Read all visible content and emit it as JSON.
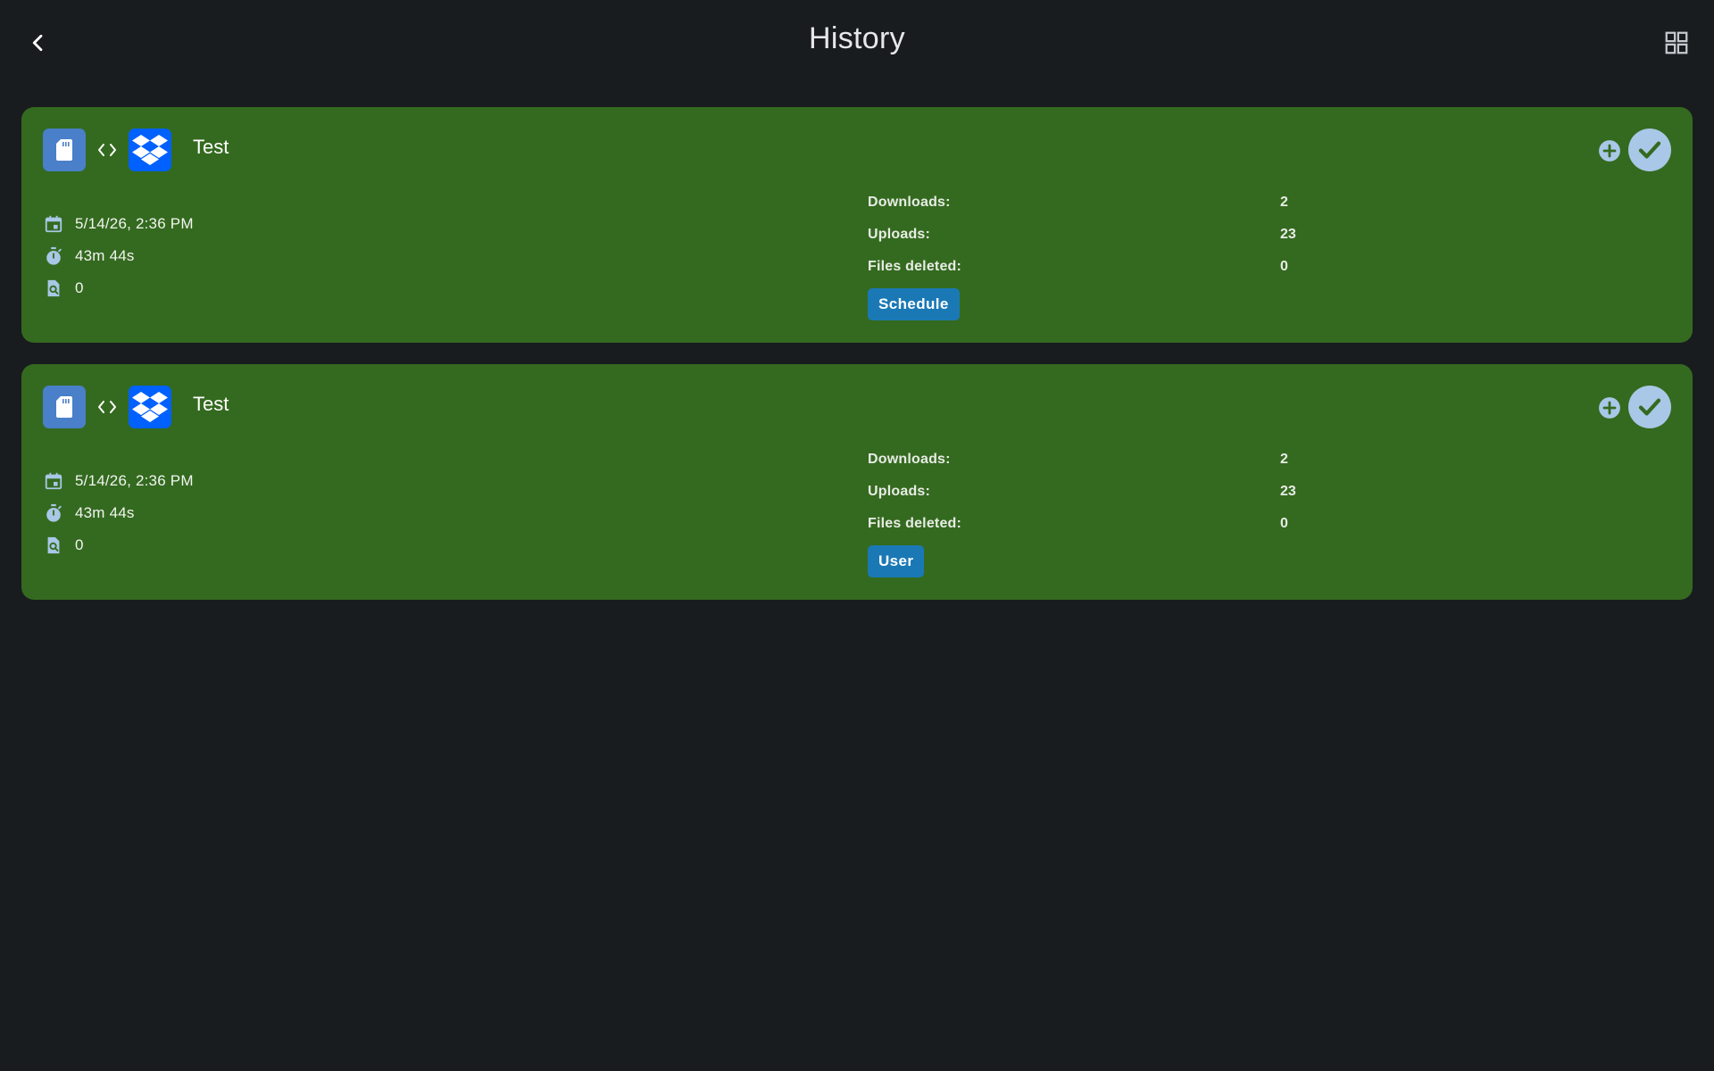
{
  "header": {
    "title": "History"
  },
  "history": [
    {
      "name": "Test",
      "date": "5/14/26, 2:36 PM",
      "duration": "43m 44s",
      "checked": "0",
      "stats": {
        "downloads_label": "Downloads:",
        "downloads_value": "2",
        "uploads_label": "Uploads:",
        "uploads_value": "23",
        "deleted_label": "Files deleted:",
        "deleted_value": "0"
      },
      "trigger": "Schedule",
      "status": "success"
    },
    {
      "name": "Test",
      "date": "5/14/26, 2:36 PM",
      "duration": "43m 44s",
      "checked": "0",
      "stats": {
        "downloads_label": "Downloads:",
        "downloads_value": "2",
        "uploads_label": "Uploads:",
        "uploads_value": "23",
        "deleted_label": "Files deleted:",
        "deleted_value": "0"
      },
      "trigger": "User",
      "status": "success"
    }
  ],
  "icons": {
    "back": "chevron-left-icon",
    "grid": "grid-view-icon",
    "source": "sd-card-icon",
    "sync": "code-arrows-icon",
    "target": "dropbox-icon",
    "add": "add-circle-icon",
    "status": "check-icon",
    "date": "calendar-icon",
    "duration": "timer-icon",
    "checked": "file-search-icon"
  },
  "colors": {
    "background": "#191c1f",
    "card_success": "#346a1f",
    "trigger_badge": "#1a79b5",
    "status_circle": "#a9c7e6",
    "dropbox_blue": "#0061fe",
    "sd_chip": "#4a7fc9"
  }
}
